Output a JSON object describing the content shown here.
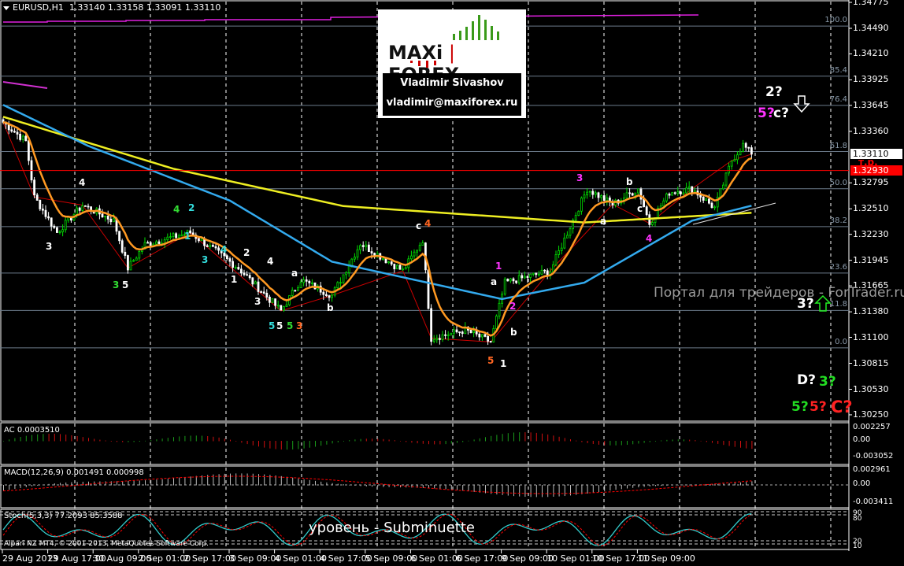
{
  "header": {
    "symbol": "EURUSD,H1",
    "open": "1.33140",
    "high": "1.33158",
    "low": "1.33091",
    "close": "1.33110"
  },
  "logo": {
    "brand_left": "MAXi",
    "brand_right": "FOREX",
    "author": "Vladimir Sivashov",
    "email": "vladimir@maxiforex.ru"
  },
  "price_axis": [
    "1.34775",
    "1.34490",
    "1.34210",
    "1.33925",
    "1.33645",
    "1.33360",
    "1.32795",
    "1.32510",
    "1.32230",
    "1.31945",
    "1.31665",
    "1.31380",
    "1.31100",
    "1.30815",
    "1.30530",
    "1.30250"
  ],
  "current_price": "1.33110",
  "target_price": "1.32930",
  "target_label": "т.р.",
  "fib_levels": [
    {
      "label": "100.0",
      "price": 1.34515
    },
    {
      "label": "85.4",
      "price": 1.33965
    },
    {
      "label": "76.4",
      "price": 1.33645
    },
    {
      "label": "61.8",
      "price": 1.33138
    },
    {
      "label": "50.0",
      "price": 1.3273
    },
    {
      "label": "38.2",
      "price": 1.32315
    },
    {
      "label": "23.6",
      "price": 1.31805
    },
    {
      "label": "11.8",
      "price": 1.31395
    },
    {
      "label": "0.0",
      "price": 1.30985
    }
  ],
  "time_axis": [
    "29 Aug 2013",
    "29 Aug 17:00",
    "30 Aug 09:00",
    "2 Sep 01:00",
    "2 Sep 17:00",
    "3 Sep 09:00",
    "4 Sep 01:00",
    "4 Sep 17:00",
    "5 Sep 09:00",
    "6 Sep 01:00",
    "6 Sep 17:00",
    "9 Sep 09:00",
    "10 Sep 01:00",
    "10 Sep 17:00",
    "11 Sep 09:00"
  ],
  "panels": {
    "ac": {
      "label": "AC 0.0003510",
      "axis": [
        "0.002257",
        "0.00",
        "-0.003052"
      ]
    },
    "macd": {
      "label": "MACD(12,26,9) 0.001491 0.000998",
      "axis": [
        "0.002961",
        "0.00",
        "-0.003411"
      ]
    },
    "stoch": {
      "label": "Stoch(5,3,3) 77.2093 85.3588",
      "axis": [
        "90",
        "80",
        "20",
        "10"
      ]
    }
  },
  "annotations": {
    "portal": "Портал для трейдеров - ForTrader.ru",
    "level": "уровень - Subminuette",
    "copyright": "Alpari NZ MT4, © 2001-2013, MetaQuotes Software Corp."
  },
  "wave_labels": [
    {
      "t": "3",
      "c": "#ffffff"
    },
    {
      "t": "4",
      "c": "#ffffff"
    },
    {
      "t": "3",
      "c": "#33dd33"
    },
    {
      "t": "5",
      "c": "#ffffff"
    },
    {
      "t": "4",
      "c": "#33dd33"
    },
    {
      "t": "2",
      "c": "#33dddd"
    },
    {
      "t": "1",
      "c": "#33dddd"
    },
    {
      "t": "3",
      "c": "#33dddd"
    },
    {
      "t": "4",
      "c": "#33dddd"
    },
    {
      "t": "2",
      "c": "#ffffff"
    },
    {
      "t": "1",
      "c": "#ffffff"
    },
    {
      "t": "4",
      "c": "#ffffff"
    },
    {
      "t": "3",
      "c": "#ffffff"
    },
    {
      "t": "a",
      "c": "#ffffff"
    },
    {
      "t": "b",
      "c": "#ffffff"
    },
    {
      "t": "5",
      "c": "#33dddd"
    },
    {
      "t": "5",
      "c": "#ffffff"
    },
    {
      "t": "5",
      "c": "#33dd33"
    },
    {
      "t": "3",
      "c": "#ff6622"
    },
    {
      "t": "c",
      "c": "#ffffff"
    },
    {
      "t": "4",
      "c": "#ff6622"
    },
    {
      "t": "1",
      "c": "#ff33ff"
    },
    {
      "t": "a",
      "c": "#ffffff"
    },
    {
      "t": "2",
      "c": "#ff33ff"
    },
    {
      "t": "b",
      "c": "#ffffff"
    },
    {
      "t": "5",
      "c": "#ff6622"
    },
    {
      "t": "1",
      "c": "#ffffff"
    },
    {
      "t": "3",
      "c": "#ff33ff"
    },
    {
      "t": "a",
      "c": "#ffffff"
    },
    {
      "t": "b",
      "c": "#ffffff"
    },
    {
      "t": "c",
      "c": "#ffffff"
    },
    {
      "t": "4",
      "c": "#ff33ff"
    }
  ],
  "forecast_labels": [
    {
      "t": "2?",
      "c": "#ffffff"
    },
    {
      "t": "5?",
      "c": "#ff33ff"
    },
    {
      "t": "c?",
      "c": "#ffffff"
    },
    {
      "t": "3?",
      "c": "#ffffff"
    },
    {
      "t": "D?",
      "c": "#ffffff"
    },
    {
      "t": "3?",
      "c": "#22dd22"
    },
    {
      "t": "5?",
      "c": "#22dd22"
    },
    {
      "t": "5?",
      "c": "#ff2222"
    },
    {
      "t": "C?",
      "c": "#ff2222"
    }
  ],
  "colors": {
    "bull": "#00dd00",
    "bear": "#ffffff",
    "ma_fast": "#ff9922",
    "ma_mid": "#33aaee",
    "ma_slow": "#eeee22",
    "fib": "#6c7b8b",
    "target": "#ff0000",
    "zigzag": "#cc0000"
  },
  "chart_data": {
    "type": "candlestick",
    "title": "EURUSD,H1",
    "ylim": [
      1.3025,
      1.34775
    ],
    "close_path": [
      [
        0,
        1.3346
      ],
      [
        8,
        1.3325
      ],
      [
        11,
        1.3264
      ],
      [
        19,
        1.3225
      ],
      [
        28,
        1.3255
      ],
      [
        39,
        1.3238
      ],
      [
        44,
        1.3186
      ],
      [
        50,
        1.3212
      ],
      [
        66,
        1.3225
      ],
      [
        83,
        1.3186
      ],
      [
        98,
        1.3139
      ],
      [
        105,
        1.3173
      ],
      [
        116,
        1.3156
      ],
      [
        126,
        1.3213
      ],
      [
        141,
        1.3183
      ],
      [
        148,
        1.3217
      ],
      [
        151,
        1.3109
      ],
      [
        163,
        1.3118
      ],
      [
        172,
        1.3105
      ],
      [
        177,
        1.317
      ],
      [
        193,
        1.3183
      ],
      [
        206,
        1.3273
      ],
      [
        215,
        1.3256
      ],
      [
        224,
        1.3273
      ],
      [
        228,
        1.3235
      ],
      [
        235,
        1.3269
      ],
      [
        243,
        1.3273
      ],
      [
        251,
        1.3252
      ],
      [
        257,
        1.3304
      ],
      [
        261,
        1.3321
      ],
      [
        264,
        1.3311
      ]
    ],
    "ma_slow": [
      [
        0,
        1.3352
      ],
      [
        60,
        1.3295
      ],
      [
        120,
        1.3254
      ],
      [
        205,
        1.3236
      ],
      [
        266,
        1.3247
      ]
    ],
    "ma_mid": [
      [
        0,
        1.3365
      ],
      [
        30,
        1.332
      ],
      [
        80,
        1.326
      ],
      [
        116,
        1.3193
      ],
      [
        176,
        1.3152
      ],
      [
        205,
        1.317
      ],
      [
        243,
        1.3238
      ],
      [
        266,
        1.3256
      ]
    ],
    "ma_fast_period": 10
  }
}
